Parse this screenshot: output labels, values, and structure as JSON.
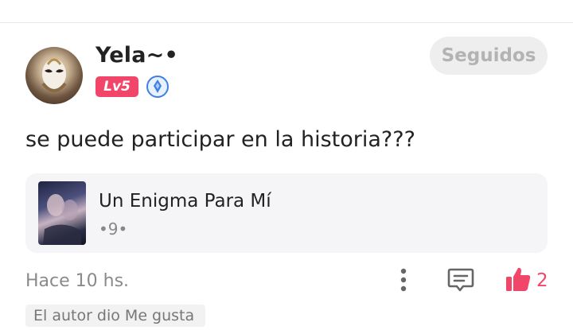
{
  "user": {
    "name": "Yela~•",
    "level": "Lv5",
    "follow_label": "Seguidos"
  },
  "comment": {
    "text": "se puede participar en la historia???",
    "timestamp": "Hace 10 hs.",
    "like_count": "2",
    "liked_by_author_label": "El autor dio Me gusta"
  },
  "story": {
    "title": "Un Enigma Para Mí",
    "author": "•9•"
  },
  "icons": {
    "crystal": "crystal-badge-icon",
    "more": "more-vertical-icon",
    "reply": "comment-reply-icon",
    "like": "thumbs-up-icon"
  },
  "colors": {
    "accent": "#f2456a",
    "follow_bg": "#eeeeee",
    "card_bg": "#f5f5f7"
  }
}
